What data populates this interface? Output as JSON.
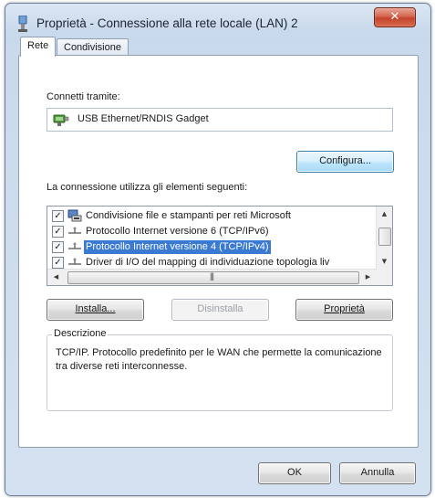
{
  "window": {
    "title": "Proprietà - Connessione alla rete locale (LAN) 2",
    "close_glyph": "✕"
  },
  "tabs": [
    {
      "label": "Rete",
      "active": true
    },
    {
      "label": "Condivisione",
      "active": false
    }
  ],
  "connect_via": {
    "label": "Connetti tramite:",
    "device_name": "USB Ethernet/RNDIS Gadget",
    "device_icon": "network-adapter-icon"
  },
  "buttons": {
    "configure": "Configura...",
    "install": "Installa...",
    "uninstall": "Disinstalla",
    "properties": "Proprietà",
    "ok": "OK",
    "cancel": "Annulla"
  },
  "items_label": "La connessione utilizza gli elementi seguenti:",
  "items": [
    {
      "label": "Condivisione file e stampanti per reti Microsoft",
      "checked": true,
      "selected": false,
      "icon": "file-printer-sharing-icon"
    },
    {
      "label": "Protocollo Internet versione 6 (TCP/IPv6)",
      "checked": true,
      "selected": false,
      "icon": "protocol-icon"
    },
    {
      "label": "Protocollo Internet versione 4 (TCP/IPv4)",
      "checked": true,
      "selected": true,
      "icon": "protocol-icon"
    },
    {
      "label": "Driver di I/O del mapping di individuazione topologia liv",
      "checked": true,
      "selected": false,
      "icon": "protocol-icon"
    }
  ],
  "description": {
    "legend": "Descrizione",
    "text": "TCP/IP. Protocollo predefinito per le WAN che permette la comunicazione tra diverse reti interconnesse."
  },
  "colors": {
    "selection": "#3b7ad2",
    "title_bar": "#c9d9ec",
    "close_button": "#c2442b"
  }
}
